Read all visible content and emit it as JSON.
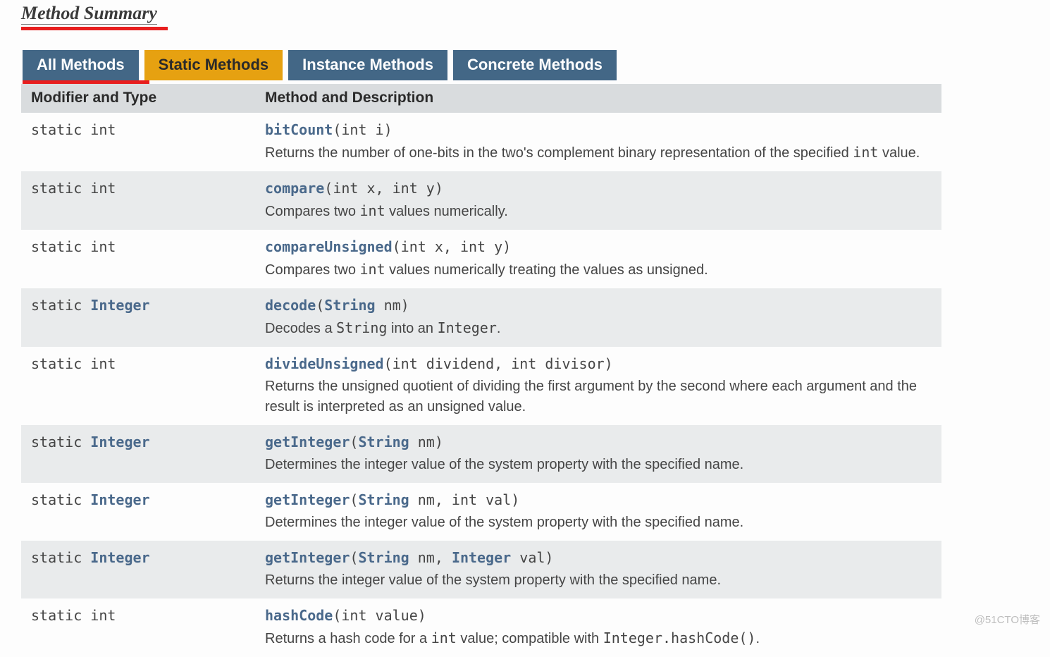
{
  "sectionTitle": "Method Summary",
  "tabs": [
    {
      "label": "All Methods",
      "style": "active-blue"
    },
    {
      "label": "Static Methods",
      "style": "active-orange"
    },
    {
      "label": "Instance Methods",
      "style": ""
    },
    {
      "label": "Concrete Methods",
      "style": ""
    }
  ],
  "columns": {
    "left": "Modifier and Type",
    "right": "Method and Description"
  },
  "rows": [
    {
      "modPrefix": "static ",
      "modType": "int",
      "modTypeLink": false,
      "name": "bitCount",
      "params": "(int i)",
      "desc": "Returns the number of one-bits in the two's complement binary representation of the specified ",
      "descTail": " value.",
      "descCode": "int"
    },
    {
      "modPrefix": "static ",
      "modType": "int",
      "modTypeLink": false,
      "name": "compare",
      "params": "(int x, int y)",
      "desc": "Compares two ",
      "descTail": " values numerically.",
      "descCode": "int"
    },
    {
      "modPrefix": "static ",
      "modType": "int",
      "modTypeLink": false,
      "name": "compareUnsigned",
      "params": "(int x, int y)",
      "desc": "Compares two ",
      "descTail": " values numerically treating the values as unsigned.",
      "descCode": "int"
    },
    {
      "modPrefix": "static ",
      "modType": "Integer",
      "modTypeLink": true,
      "name": "decode",
      "paramsPlain": "(",
      "paramTypes": [
        {
          "t": "String",
          "link": true
        },
        {
          "t": " nm)",
          "link": false
        }
      ],
      "desc": "Decodes a ",
      "descCode": "String",
      "descTail": " into an ",
      "descCode2": "Integer",
      "descTail2": "."
    },
    {
      "modPrefix": "static ",
      "modType": "int",
      "modTypeLink": false,
      "name": "divideUnsigned",
      "params": "(int dividend, int divisor)",
      "desc": "Returns the unsigned quotient of dividing the first argument by the second where each argument and the result is interpreted as an unsigned value.",
      "descTail": "",
      "descCode": ""
    },
    {
      "modPrefix": "static ",
      "modType": "Integer",
      "modTypeLink": true,
      "name": "getInteger",
      "paramsPlain": "(",
      "paramTypes": [
        {
          "t": "String",
          "link": true
        },
        {
          "t": " nm)",
          "link": false
        }
      ],
      "desc": "Determines the integer value of the system property with the specified name.",
      "descTail": "",
      "descCode": ""
    },
    {
      "modPrefix": "static ",
      "modType": "Integer",
      "modTypeLink": true,
      "name": "getInteger",
      "paramsPlain": "(",
      "paramTypes": [
        {
          "t": "String",
          "link": true
        },
        {
          "t": " nm, int val)",
          "link": false
        }
      ],
      "desc": "Determines the integer value of the system property with the specified name.",
      "descTail": "",
      "descCode": ""
    },
    {
      "modPrefix": "static ",
      "modType": "Integer",
      "modTypeLink": true,
      "name": "getInteger",
      "paramsPlain": "(",
      "paramTypes": [
        {
          "t": "String",
          "link": true
        },
        {
          "t": " nm, ",
          "link": false
        },
        {
          "t": "Integer",
          "link": true
        },
        {
          "t": " val)",
          "link": false
        }
      ],
      "desc": "Returns the integer value of the system property with the specified name.",
      "descTail": "",
      "descCode": ""
    },
    {
      "modPrefix": "static ",
      "modType": "int",
      "modTypeLink": false,
      "name": "hashCode",
      "params": "(int value)",
      "desc": "Returns a hash code for a ",
      "descCode": "int",
      "descTail": " value; compatible with ",
      "descCode2": "Integer.hashCode()",
      "descTail2": "."
    }
  ],
  "watermark": "@51CTO博客"
}
